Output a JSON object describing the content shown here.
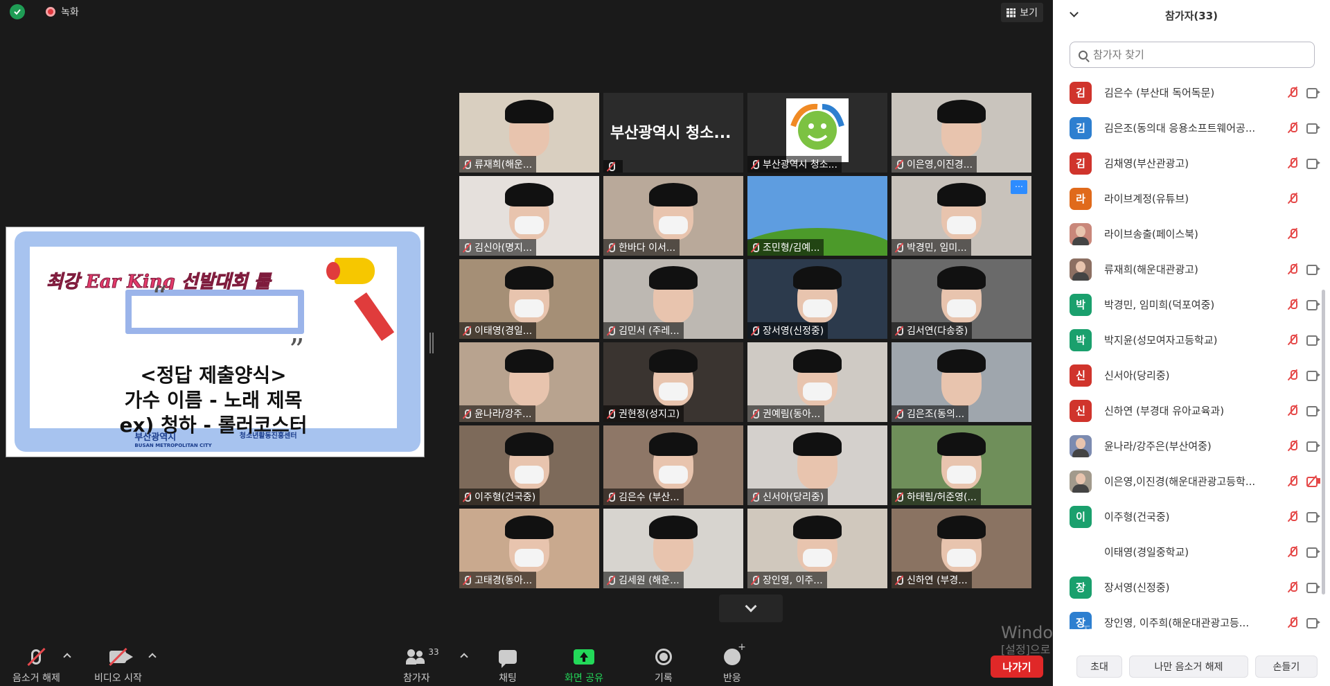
{
  "meeting": {
    "recording_label": "녹화",
    "view_label": "보기"
  },
  "share": {
    "title": "최강 Ear King 선발대회 룰",
    "lines": [
      "<정답 제출양식>",
      "가수 이름 - 노래 제목",
      "ex) 청하 - 롤러코스터"
    ],
    "logo_left": "부산광역시",
    "logo_left_sub": "BUSAN METROPOLITAN CITY",
    "logo_right": "청소년활동진흥센터"
  },
  "tiles": [
    {
      "name": "류재희(해운...",
      "bg": "#d9cfc0"
    },
    {
      "name": "",
      "bg": "#2b2b2b",
      "big": "부산광역시 청소..."
    },
    {
      "name": "부산광역시 청소...",
      "bg": "#2b2b2b",
      "active": true,
      "logo": true
    },
    {
      "name": "이은영,이진경...",
      "bg": "#c9c4bd"
    },
    {
      "name": "김신아(명지...",
      "bg": "#e5e0dc"
    },
    {
      "name": "한바다 이서...",
      "bg": "#b9a99a"
    },
    {
      "name": "조민형/김예...",
      "bg": "#5e9de0",
      "hill": true
    },
    {
      "name": "박경민, 임미...",
      "bg": "#c8c2bb",
      "more": true
    },
    {
      "name": "이태영(경일...",
      "bg": "#a58f76"
    },
    {
      "name": "김민서 (주레...",
      "bg": "#bdb8b2"
    },
    {
      "name": "장서영(신정중)",
      "bg": "#2c3a4c"
    },
    {
      "name": "김서연(다송중)",
      "bg": "#6a6a6a"
    },
    {
      "name": "윤나라/강주...",
      "bg": "#b8a38f"
    },
    {
      "name": "권현정(성지고)",
      "bg": "#3a3430"
    },
    {
      "name": "권예림(동아...",
      "bg": "#cfcac4"
    },
    {
      "name": "김은조(동의...",
      "bg": "#9fa6ad"
    },
    {
      "name": "이주형(건국중)",
      "bg": "#7d6a5a"
    },
    {
      "name": "김은수 (부산...",
      "bg": "#8e7767"
    },
    {
      "name": "신서아(당리중)",
      "bg": "#d4d0cc"
    },
    {
      "name": "하태림/허준영(...",
      "bg": "#6f8f5a"
    },
    {
      "name": "고태경(동아...",
      "bg": "#c9a98e"
    },
    {
      "name": "김세원 (해운...",
      "bg": "#d7d4cf"
    },
    {
      "name": "장인영, 이주...",
      "bg": "#d0c8bd"
    },
    {
      "name": "신하연 (부경...",
      "bg": "#8a7362"
    }
  ],
  "toolbar": {
    "unmute": "음소거 해제",
    "start_video": "비디오 시작",
    "participants": "참가자",
    "participant_count": "33",
    "chat": "채팅",
    "share_screen": "화면 공유",
    "record": "기록",
    "reactions": "반응",
    "leave": "나가기"
  },
  "watermark": {
    "line1": "Windows 정품 인증",
    "line2": "[설정]으로 이동하여 Windows를 정품 인증합니다."
  },
  "panel": {
    "title": "참가자(33)",
    "search_placeholder": "참가자 찾기",
    "participants": [
      {
        "initial": "김",
        "color": "#d0342c",
        "name": "김은수 (부산대 독어독문)",
        "video": true
      },
      {
        "initial": "김",
        "color": "#2d7fd0",
        "name": "김은조(동의대 응용소프트웨어공...",
        "video": true
      },
      {
        "initial": "김",
        "color": "#d0342c",
        "name": "김채영(부산관광고)",
        "video": true
      },
      {
        "initial": "라",
        "color": "#e06a1b",
        "name": "라이브계정(유튜브)",
        "video": false
      },
      {
        "initial": "",
        "color": "#c9877a",
        "name": "라이브송출(페이스북)",
        "video": false,
        "photo": true
      },
      {
        "initial": "",
        "color": "#8c6f62",
        "name": "류재희(해운대관광고)",
        "video": true,
        "photo": true
      },
      {
        "initial": "박",
        "color": "#1aa06d",
        "name": "박경민, 임미희(덕포여중)",
        "video": true
      },
      {
        "initial": "박",
        "color": "#1aa06d",
        "name": "박지윤(성모여자고등학교)",
        "video": true
      },
      {
        "initial": "신",
        "color": "#d0342c",
        "name": "신서아(당리중)",
        "video": true
      },
      {
        "initial": "신",
        "color": "#d0342c",
        "name": "신하연 (부경대 유아교육과)",
        "video": true
      },
      {
        "initial": "",
        "color": "#7c8bb0",
        "name": "윤나라/강주은(부산여중)",
        "video": true,
        "photo": true
      },
      {
        "initial": "",
        "color": "#a29a8c",
        "name": "이은영,이진경(해운대관광고등학...",
        "video": true,
        "photo": true,
        "video_off": true
      },
      {
        "initial": "이",
        "color": "#1aa06d",
        "name": "이주형(건국중)",
        "video": true
      },
      {
        "initial": "",
        "color": "#ffffff",
        "name": "이태영(경일중학교)",
        "video": true
      },
      {
        "initial": "장",
        "color": "#1aa06d",
        "name": "장서영(신정중)",
        "video": true
      },
      {
        "initial": "장",
        "color": "#2d7fd0",
        "name": "장인영, 이주희(해운대관광고등...",
        "video": true
      }
    ],
    "footer": {
      "invite": "초대",
      "mute_me": "나만 음소거 해제",
      "raise_hand": "손들기"
    }
  }
}
